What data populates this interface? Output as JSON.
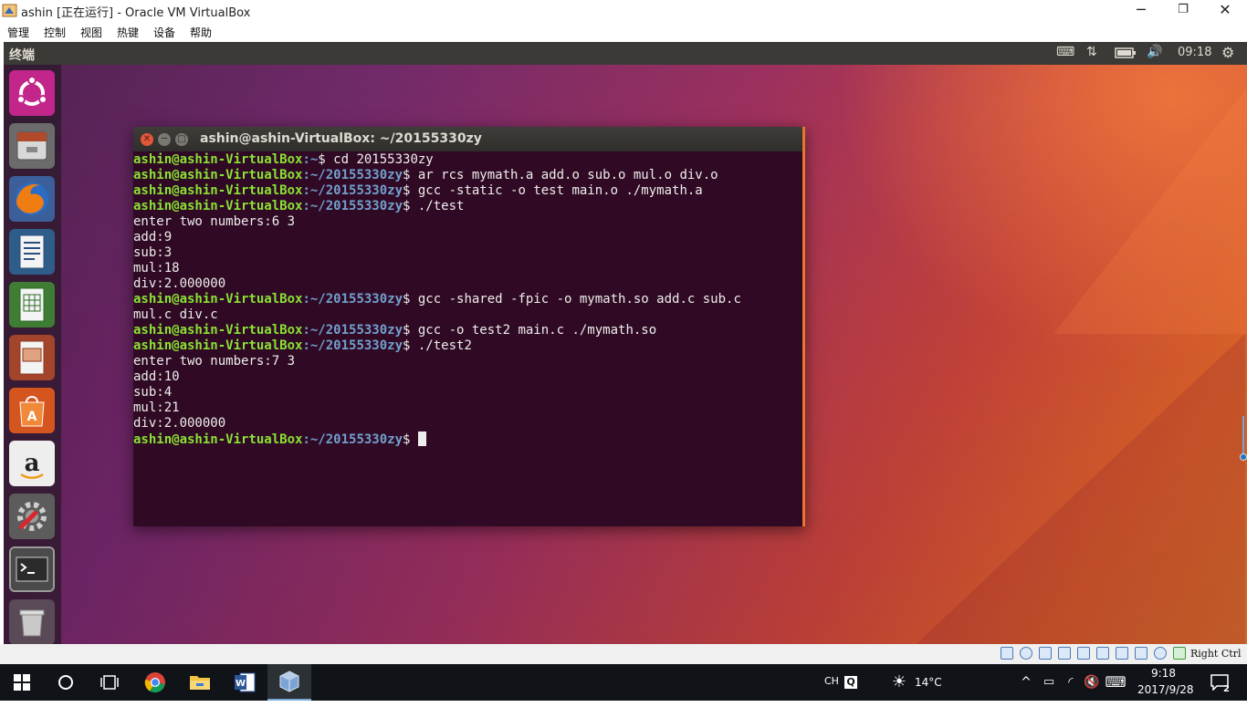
{
  "vbox": {
    "title": "ashin [正在运行] - Oracle VM VirtualBox",
    "menu": [
      "管理",
      "控制",
      "视图",
      "热键",
      "设备",
      "帮助"
    ],
    "minimize": "─",
    "restore": "❐",
    "close": "✕",
    "host_key": "Right Ctrl"
  },
  "guest": {
    "panel_title": "终端",
    "time": "09:18",
    "terminal": {
      "title": "ashin@ashin-VirtualBox: ~/20155330zy",
      "prompt_user": "ashin@ashin-VirtualBox",
      "lines": [
        {
          "path": ":~",
          "cmd": "$ cd 20155330zy"
        },
        {
          "path": ":~/20155330zy",
          "cmd": "$ ar rcs mymath.a add.o sub.o mul.o div.o"
        },
        {
          "path": ":~/20155330zy",
          "cmd": "$ gcc -static -o test main.o ./mymath.a"
        },
        {
          "path": ":~/20155330zy",
          "cmd": "$ ./test"
        },
        {
          "text": "enter two numbers:6 3"
        },
        {
          "text": "add:9"
        },
        {
          "text": "sub:3"
        },
        {
          "text": "mul:18"
        },
        {
          "text": "div:2.000000"
        },
        {
          "path": ":~/20155330zy",
          "cmd": "$ gcc -shared -fpic -o mymath.so add.c sub.c"
        },
        {
          "text": "mul.c div.c"
        },
        {
          "path": ":~/20155330zy",
          "cmd": "$ gcc -o test2 main.c ./mymath.so"
        },
        {
          "path": ":~/20155330zy",
          "cmd": "$ ./test2"
        },
        {
          "text": "enter two numbers:7 3"
        },
        {
          "text": "add:10"
        },
        {
          "text": "sub:4"
        },
        {
          "text": "mul:21"
        },
        {
          "text": "div:2.000000"
        },
        {
          "path": ":~/20155330zy",
          "cmd": "$ ",
          "cursor": true
        }
      ]
    },
    "launcher_icons": [
      "ubuntu-dash-icon",
      "files-icon",
      "firefox-icon",
      "writer-icon",
      "calc-icon",
      "impress-icon",
      "software-center-icon",
      "amazon-icon",
      "settings-icon",
      "terminal-icon",
      "trash-icon"
    ],
    "colors": {
      "prompt_user": "#8ae234",
      "prompt_path": "#729fcf",
      "terminal_bg": "#300a24"
    }
  },
  "taskbar": {
    "ime": "CH",
    "temperature": "14°C",
    "time": "9:18",
    "date": "2017/9/28",
    "notifications": "2"
  }
}
